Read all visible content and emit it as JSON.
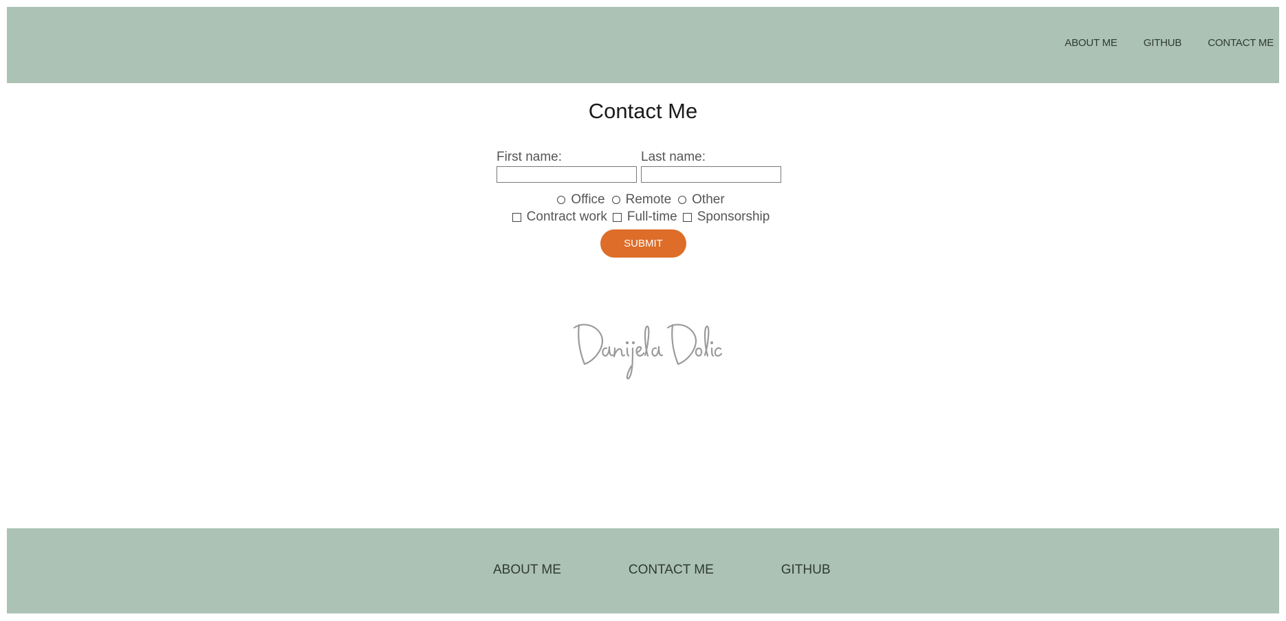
{
  "header": {
    "nav": [
      "ABOUT ME",
      "GITHUB",
      "CONTACT ME"
    ]
  },
  "main": {
    "title": "Contact Me",
    "form": {
      "first_name_label": "First name:",
      "first_name_value": "",
      "last_name_label": "Last name:",
      "last_name_value": "",
      "radios": [
        "Office",
        "Remote",
        "Other"
      ],
      "checkboxes": [
        "Contract work",
        "Full-time",
        "Sponsorship"
      ],
      "submit_label": "SUBMIT"
    },
    "signature_text": "Danijela Dolic"
  },
  "footer": {
    "nav": [
      "ABOUT ME",
      "CONTACT ME",
      "GITHUB"
    ]
  },
  "colors": {
    "header_bg": "#acc2b5",
    "accent": "#dd6d28"
  }
}
